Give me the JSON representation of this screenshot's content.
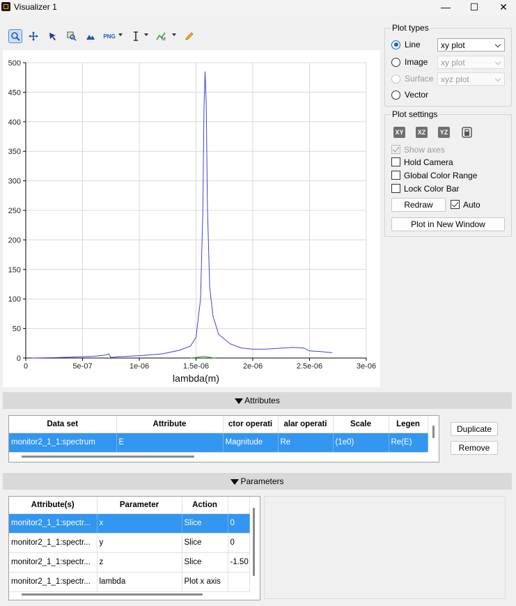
{
  "window": {
    "title": "Visualizer 1",
    "minimize": "—",
    "maximize": "☐",
    "close": "✕"
  },
  "toolbar": {
    "tools": [
      "zoom-tool",
      "pan-tool",
      "select-tool",
      "zoom-region-tool",
      "mountain-tool",
      "png-export",
      "text-tool",
      "marker-tool",
      "pencil-tool"
    ],
    "png_label": "PNG"
  },
  "plot_types": {
    "title": "Plot types",
    "options": [
      {
        "label": "Line",
        "selected": true,
        "enabled": true,
        "combo": "xy plot"
      },
      {
        "label": "Image",
        "selected": false,
        "enabled": true,
        "combo": "xy plot"
      },
      {
        "label": "Surface",
        "selected": false,
        "enabled": false,
        "combo": "xyz plot"
      },
      {
        "label": "Vector",
        "selected": false,
        "enabled": true,
        "combo": ""
      }
    ]
  },
  "plot_settings": {
    "title": "Plot settings",
    "view_icons": [
      "XY",
      "XZ",
      "YZ"
    ],
    "show_axes": "Show axes",
    "hold_camera": "Hold Camera",
    "global_color_range": "Global Color Range",
    "lock_color_bar": "Lock Color Bar",
    "redraw": "Redraw",
    "auto": "Auto",
    "plot_new_window": "Plot in New Window"
  },
  "chart_data": {
    "type": "line",
    "xlabel": "lambda(m)",
    "ylabel": "",
    "title": "",
    "xlim": [
      0,
      3e-06
    ],
    "ylim": [
      0,
      500
    ],
    "x_ticks": [
      "0",
      "5e-07",
      "1e-06",
      "1.5e-06",
      "2e-06",
      "2.5e-06",
      "3e-06"
    ],
    "y_ticks": [
      "0",
      "50",
      "100",
      "150",
      "200",
      "250",
      "300",
      "350",
      "400",
      "450",
      "500"
    ],
    "grid": true,
    "series": [
      {
        "color": "#4040d8",
        "x": [
          5e-08,
          3e-07,
          6e-07,
          7e-07,
          7.3e-07,
          7.5e-07,
          8e-07,
          1e-06,
          1.2e-06,
          1.35e-06,
          1.45e-06,
          1.5e-06,
          1.54e-06,
          1.56e-06,
          1.57e-06,
          1.58e-06,
          1.59e-06,
          1.6e-06,
          1.62e-06,
          1.65e-06,
          1.7e-06,
          1.8e-06,
          1.9e-06,
          2e-06,
          2.1e-06,
          2.2e-06,
          2.35e-06,
          2.45e-06,
          2.5e-06,
          2.6e-06,
          2.7e-06
        ],
        "y": [
          0,
          1,
          3,
          5,
          7,
          1,
          2,
          4,
          7,
          13,
          20,
          35,
          100,
          250,
          420,
          485,
          430,
          260,
          120,
          70,
          40,
          24,
          17,
          15,
          15,
          16,
          18,
          17,
          12,
          11,
          9
        ]
      },
      {
        "color": "#2ea82e",
        "x": [
          1.45e-06,
          1.5e-06,
          1.53e-06,
          1.57e-06,
          1.6e-06,
          1.63e-06,
          1.67e-06
        ],
        "y": [
          0,
          1,
          2,
          3,
          2,
          1,
          0
        ]
      }
    ]
  },
  "attributes": {
    "header": "Attributes",
    "columns": [
      "Data set",
      "Attribute",
      "ctor operati",
      "alar operati",
      "Scale",
      "Legen"
    ],
    "rows": [
      [
        "monitor2_1_1:spectrum",
        "E",
        "Magnitude",
        "Re",
        "(1e0)",
        "Re(E)"
      ]
    ],
    "duplicate": "Duplicate",
    "remove": "Remove"
  },
  "parameters": {
    "header": "Parameters",
    "columns": [
      "Attribute(s)",
      "Parameter",
      "Action",
      ""
    ],
    "rows": [
      [
        "monitor2_1_1:spectr...",
        "x",
        "Slice",
        "0"
      ],
      [
        "monitor2_1_1:spectr...",
        "y",
        "Slice",
        "0"
      ],
      [
        "monitor2_1_1:spectr...",
        "z",
        "Slice",
        "-1.50"
      ],
      [
        "monitor2_1_1:spectr...",
        "lambda",
        "Plot x axis",
        ""
      ]
    ]
  }
}
